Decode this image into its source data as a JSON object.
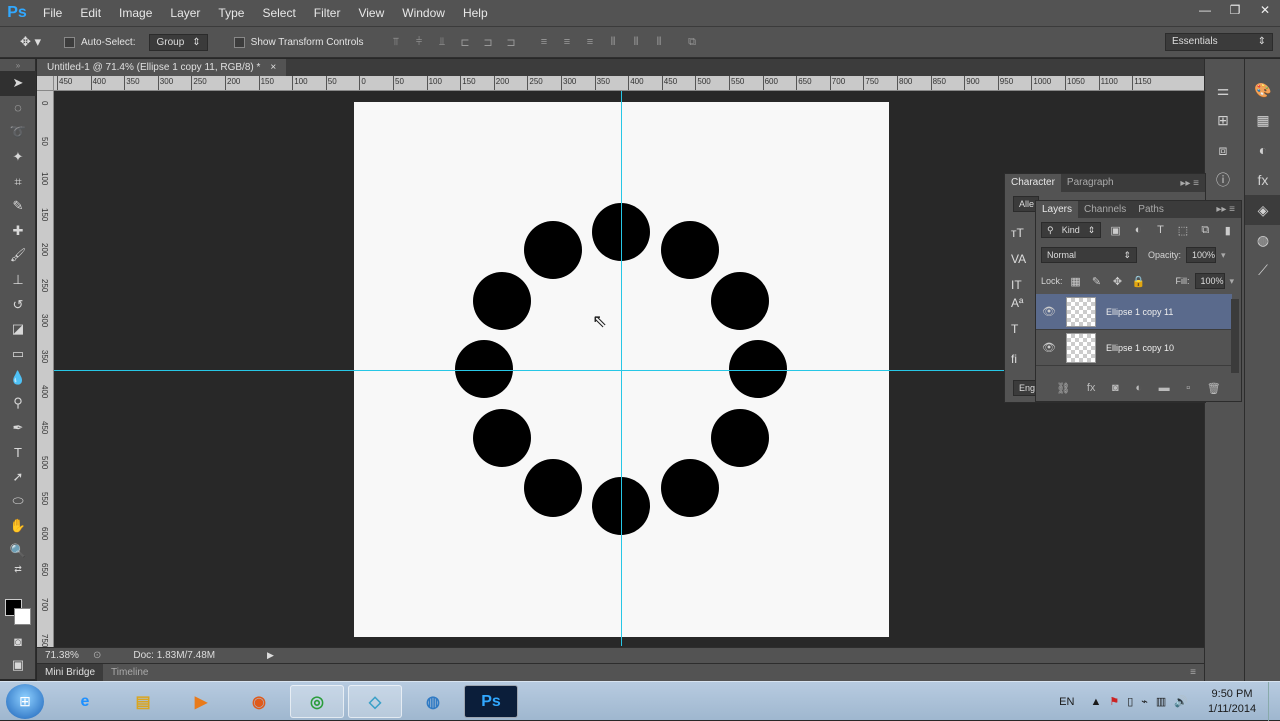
{
  "app": {
    "logo": "Ps"
  },
  "menu": [
    "File",
    "Edit",
    "Image",
    "Layer",
    "Type",
    "Select",
    "Filter",
    "View",
    "Window",
    "Help"
  ],
  "window_controls": {
    "minimize": "—",
    "restore": "❐",
    "close": "✕"
  },
  "options_bar": {
    "tool_icon": "move-tool-icon",
    "auto_select_label": "Auto-Select:",
    "auto_select_value": "Group",
    "transform_label": "Show Transform Controls",
    "workspace": "Essentials"
  },
  "document": {
    "tab_title": "Untitled-1 @ 71.4% (Ellipse 1 copy 11, RGB/8) *",
    "close": "×"
  },
  "rulers": {
    "top_labels": [
      "450",
      "400",
      "350",
      "300",
      "250",
      "200",
      "150",
      "100",
      "50",
      "0",
      "50",
      "100",
      "150",
      "200",
      "250",
      "300",
      "350",
      "400",
      "450",
      "500",
      "550",
      "600",
      "650",
      "700",
      "750",
      "800",
      "850",
      "900",
      "950",
      "1000",
      "1050",
      "1100",
      "1150"
    ],
    "left_labels": [
      "0",
      "5 0",
      "1 0 0",
      "1 5 0",
      "2 0 0",
      "2 5 0",
      "3 0 0",
      "3 5 0",
      "4 0 0",
      "4 5 0",
      "5 0 0",
      "5 5 0",
      "6 0 0",
      "6 5 0",
      "7 0 0",
      "7 5 0"
    ]
  },
  "status": {
    "zoom": "71.38%",
    "doc": "Doc: 1.83M/7.48M"
  },
  "mini_bridge": {
    "tabs": [
      "Mini Bridge",
      "Timeline"
    ]
  },
  "character_panel": {
    "tabs": [
      "Character",
      "Paragraph"
    ],
    "font_field": "Alle",
    "lang_field": "Eng"
  },
  "layers_panel": {
    "tabs": [
      "Layers",
      "Channels",
      "Paths"
    ],
    "kind_label": "Kind",
    "blend_mode": "Normal",
    "opacity_label": "Opacity:",
    "opacity_value": "100%",
    "lock_label": "Lock:",
    "fill_label": "Fill:",
    "fill_value": "100%",
    "layers": [
      {
        "name": "Ellipse 1 copy 11",
        "selected": true
      },
      {
        "name": "Ellipse 1 copy 10",
        "selected": false
      }
    ]
  },
  "taskbar": {
    "apps": [
      "internet-explorer",
      "file-explorer",
      "media-player",
      "firefox",
      "chrome",
      "notes",
      "network",
      "photoshop"
    ],
    "photoshop_label": "Ps",
    "tray": {
      "lang": "EN",
      "time": "9:50 PM",
      "date": "1/11/2014"
    }
  }
}
